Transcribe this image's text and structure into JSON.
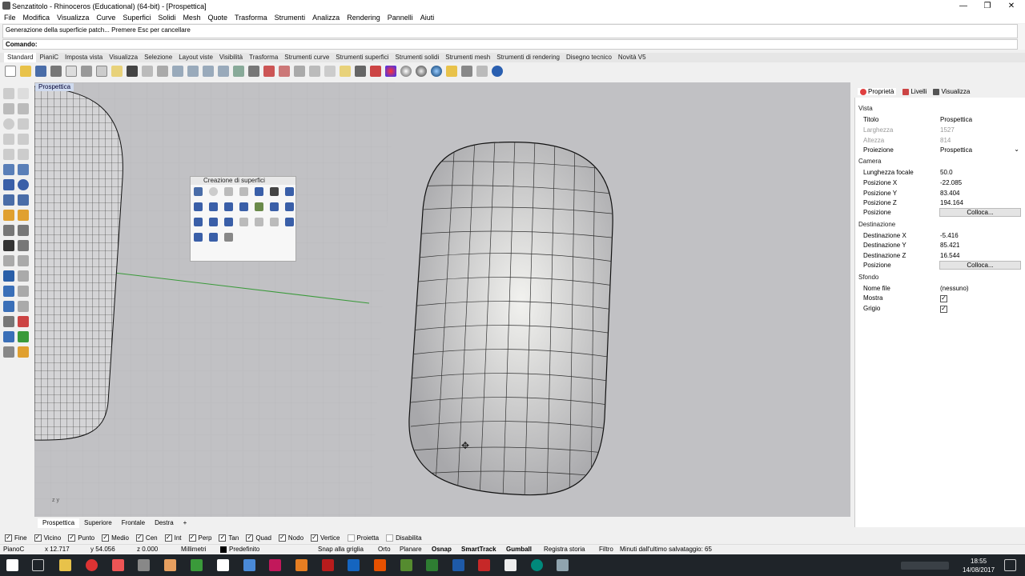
{
  "window": {
    "title": "Senzatitolo - Rhinoceros (Educational) (64-bit) - [Prospettica]",
    "controls": [
      "—",
      "❐",
      "✕"
    ]
  },
  "menu": [
    "File",
    "Modifica",
    "Visualizza",
    "Curve",
    "Superfici",
    "Solidi",
    "Mesh",
    "Quote",
    "Trasforma",
    "Strumenti",
    "Analizza",
    "Rendering",
    "Pannelli",
    "Aiuti"
  ],
  "command": {
    "history": "Generazione della superficie patch... Premere Esc per cancellare",
    "prompt": "Comando:"
  },
  "toolbar_tabs": [
    "Standard",
    "PianiC",
    "Imposta vista",
    "Visualizza",
    "Selezione",
    "Layout viste",
    "Visibilità",
    "Trasforma",
    "Strumenti curve",
    "Strumenti superfici",
    "Strumenti solidi",
    "Strumenti mesh",
    "Strumenti di rendering",
    "Disegno tecnico",
    "Novità V5"
  ],
  "viewport": {
    "label": "Prospettica",
    "axis_label": "z  y"
  },
  "palette": {
    "title": "Creazione di superfici"
  },
  "viewport_tabs": [
    "Prospettica",
    "Superiore",
    "Frontale",
    "Destra",
    "+"
  ],
  "osnap": [
    {
      "label": "Fine",
      "checked": true
    },
    {
      "label": "Vicino",
      "checked": true
    },
    {
      "label": "Punto",
      "checked": true
    },
    {
      "label": "Medio",
      "checked": true
    },
    {
      "label": "Cen",
      "checked": true
    },
    {
      "label": "Int",
      "checked": true
    },
    {
      "label": "Perp",
      "checked": true
    },
    {
      "label": "Tan",
      "checked": true
    },
    {
      "label": "Quad",
      "checked": true
    },
    {
      "label": "Nodo",
      "checked": true
    },
    {
      "label": "Vertice",
      "checked": true
    },
    {
      "label": "Proietta",
      "checked": false
    },
    {
      "label": "Disabilita",
      "checked": false
    }
  ],
  "status": {
    "cplane": "PianoC",
    "x": "x 12.717",
    "y": "y 54.056",
    "z": "z 0.000",
    "units": "Millimetri",
    "layer": "Predefinito",
    "snap": "Snap alla griglia",
    "ortho": "Orto",
    "planar": "Planare",
    "osnap": "Osnap",
    "smarttrack": "SmartTrack",
    "gumball": "Gumball",
    "history": "Registra storia",
    "filter": "Filtro",
    "autosave": "Minuti dall'ultimo salvataggio: 65"
  },
  "panel": {
    "tabs": [
      "Proprietà",
      "Livelli",
      "Visualizza"
    ],
    "sections": {
      "vista": "Vista",
      "camera": "Camera",
      "destinazione": "Destinazione",
      "sfondo": "Sfondo"
    },
    "vista_rows": [
      {
        "k": "Titolo",
        "v": "Prospettica"
      },
      {
        "k": "Larghezza",
        "v": "1527"
      },
      {
        "k": "Altezza",
        "v": "814"
      },
      {
        "k": "Proiezione",
        "v": "Prospettica"
      }
    ],
    "camera_rows": [
      {
        "k": "Lunghezza focale",
        "v": "50.0"
      },
      {
        "k": "Posizione X",
        "v": "-22.085"
      },
      {
        "k": "Posizione Y",
        "v": "83.404"
      },
      {
        "k": "Posizione Z",
        "v": "194.164"
      },
      {
        "k": "Posizione",
        "v": "Colloca..."
      }
    ],
    "dest_rows": [
      {
        "k": "Destinazione X",
        "v": "-5.416"
      },
      {
        "k": "Destinazione Y",
        "v": "85.421"
      },
      {
        "k": "Destinazione Z",
        "v": "16.544"
      },
      {
        "k": "Posizione",
        "v": "Colloca..."
      }
    ],
    "sfondo_rows": [
      {
        "k": "Nome file",
        "v": "(nessuno)"
      },
      {
        "k": "Mostra",
        "v": "✓"
      },
      {
        "k": "Grigio",
        "v": "✓"
      }
    ]
  },
  "clock": {
    "time": "18:55",
    "date": "14/08/2017"
  },
  "colors": {
    "viewport_bg": "#c1c1c4",
    "panel_bg": "#ffffff",
    "taskbar": "#1f2429"
  }
}
